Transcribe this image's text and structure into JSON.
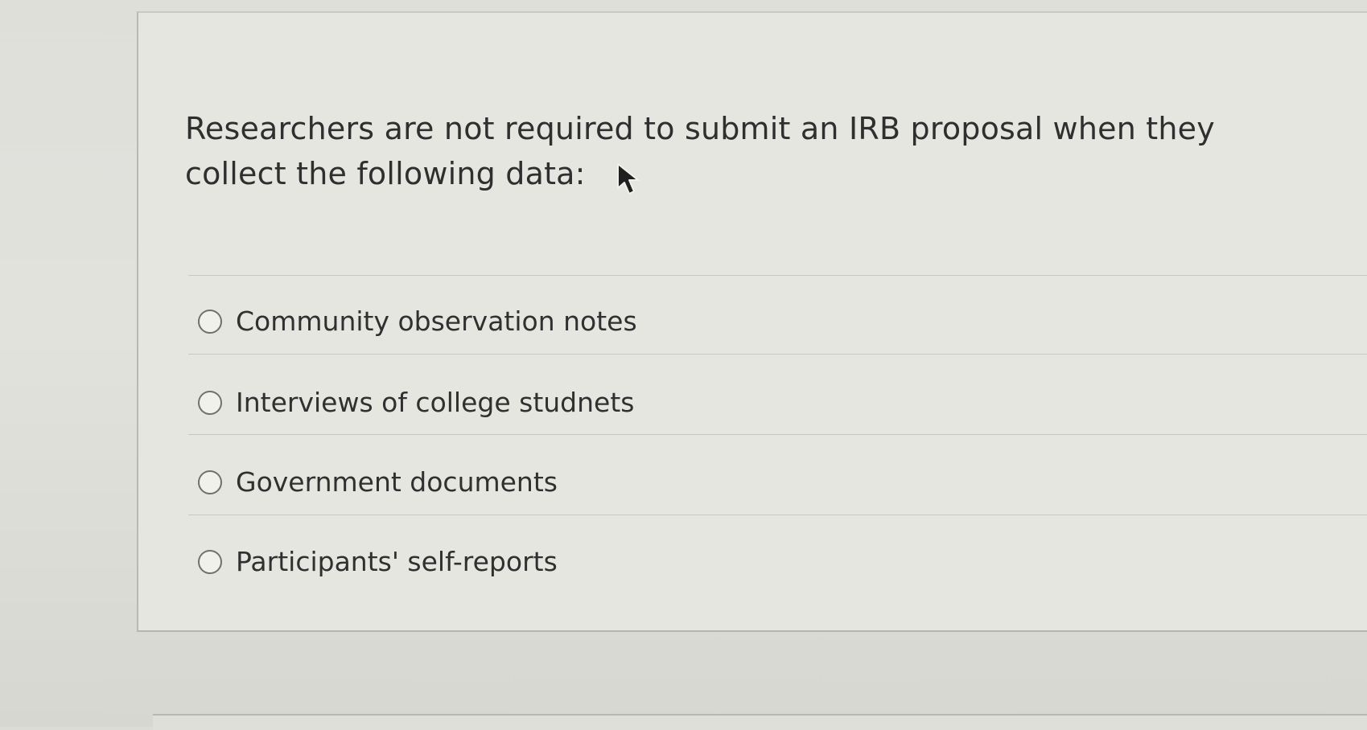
{
  "question": {
    "text": "Researchers are not required to submit an IRB proposal when they collect the following data:"
  },
  "options": [
    {
      "label": "Community observation notes",
      "selected": false
    },
    {
      "label": "Interviews of college studnets",
      "selected": false
    },
    {
      "label": "Government documents",
      "selected": false
    },
    {
      "label": "Participants' self-reports",
      "selected": false
    }
  ],
  "icons": {
    "radio": "radio-unchecked-icon",
    "cursor": "mouse-pointer-icon"
  },
  "colors": {
    "page_background": "#dcdcd7",
    "card_background": "#e6e6e1",
    "text": "#2f2f2f",
    "divider": "#c8c8c3",
    "radio_border": "#707070"
  }
}
